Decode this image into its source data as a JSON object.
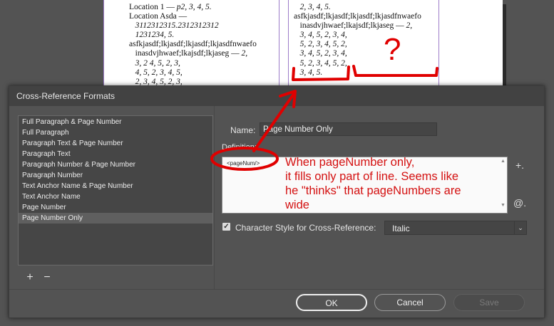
{
  "document": {
    "left_column_lines": [
      {
        "plain": "Location 1 — ",
        "italic": "p2, 3, 4, 5."
      },
      {
        "plain": "Location Asda —",
        "italic": ""
      },
      {
        "plain": "   ",
        "italic": "3112312315.2312312312"
      },
      {
        "plain": "   ",
        "italic": "1231234, 5."
      },
      {
        "plain": "asfkjasdf;lkjasdf;lkjasdf;lkjasdfnwaefo",
        "italic": ""
      },
      {
        "plain": "   inasdvjhwaef;lkajsdf;lkjaseg — ",
        "italic": "2,"
      },
      {
        "plain": "   ",
        "italic": "3, 2 4, 5, 2, 3,"
      },
      {
        "plain": "   ",
        "italic": "4, 5, 2, 3, 4, 5,"
      },
      {
        "plain": "   ",
        "italic": "2, 3, 4, 5, 2, 3,"
      }
    ],
    "right_column_lines": [
      {
        "plain": "   ",
        "italic": "2, 3, 4, 5."
      },
      {
        "plain": "asfkjasdf;lkjasdf;lkjasdf;lkjasdfnwaefo",
        "italic": ""
      },
      {
        "plain": "   inasdvjhwaef;lkajsdf;lkjaseg — ",
        "italic": "2,"
      },
      {
        "plain": "   ",
        "italic": "3, 4, 5, 2, 3, 4,"
      },
      {
        "plain": "   ",
        "italic": "5, 2, 3, 4, 5, 2,"
      },
      {
        "plain": "   ",
        "italic": "3, 4, 5, 2, 3, 4,"
      },
      {
        "plain": "   ",
        "italic": "5, 2, 3, 4, 5, 2,"
      },
      {
        "plain": "   ",
        "italic": "3, 4, 5."
      }
    ]
  },
  "dialog": {
    "title": "Cross-Reference Formats",
    "formats": [
      "Full Paragraph & Page Number",
      "Full Paragraph",
      "Paragraph Text & Page Number",
      "Paragraph Text",
      "Paragraph Number & Page Number",
      "Paragraph Number",
      "Text Anchor Name & Page Number",
      "Text Anchor Name",
      "Page Number",
      "Page Number Only"
    ],
    "selected_format": "Page Number Only",
    "add_symbol": "+",
    "remove_symbol": "−",
    "name_label": "Name:",
    "name_value": "Page Number Only",
    "definition_label": "Definition:",
    "definition_value": "<pageNum/>",
    "insert_building_block_symbol": "+.",
    "insert_special_char_symbol": "@.",
    "char_style_checked": true,
    "char_style_label": "Character Style for Cross-Reference:",
    "char_style_value": "Italic",
    "ok_label": "OK",
    "cancel_label": "Cancel",
    "save_label": "Save"
  },
  "annotation": {
    "question_mark": "?",
    "note": "When pageNumber only,\nit fills only part of line. Seems like\nhe \"thinks\" that pageNumbers are\nwide",
    "color": "#e00000"
  }
}
